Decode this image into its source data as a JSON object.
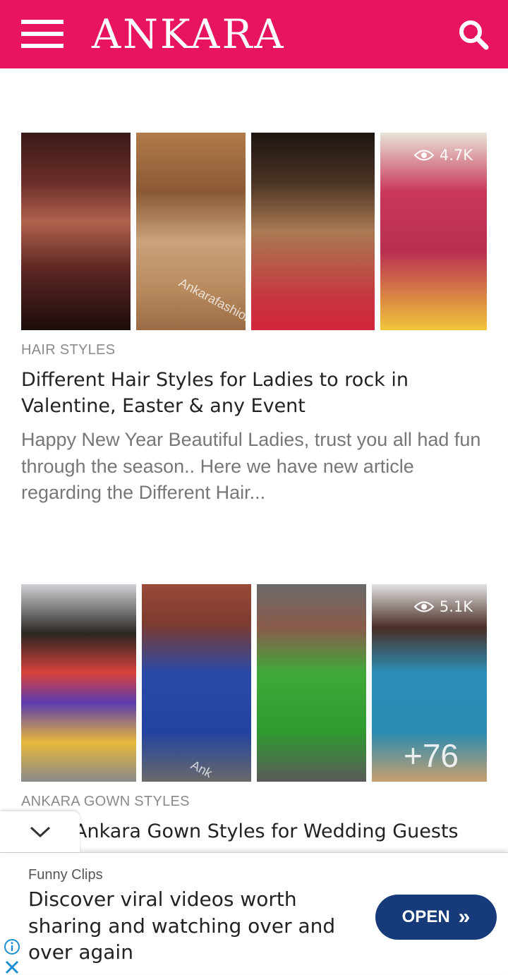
{
  "header": {
    "logo_text": "ANKARA",
    "menu_icon": "hamburger-icon",
    "search_icon": "search-icon",
    "brand_color": "#e8145f"
  },
  "articles": [
    {
      "views": "4.7K",
      "watermark": "Ankarafashion",
      "category": "HAIR STYLES",
      "title": "Different Hair Styles for Ladies to rock in Valentine, Easter & any Event",
      "excerpt": "Happy New Year Beautiful Ladies, trust you all had fun through the season.. Here we have new article regarding the Different Hair..."
    },
    {
      "views": "5.1K",
      "watermark": "Ank",
      "extra_count": "+76",
      "category": "ANKARA GOWN STYLES",
      "title": "Ankara Gown Styles for Wedding Guests"
    }
  ],
  "ad": {
    "source": "Funny Clips",
    "headline": "Discover viral videos worth sharing and watching over and over again",
    "cta": "OPEN",
    "cta_icon": "double-chevron-right-icon",
    "cta_color": "#163a7a",
    "info_icon": "info-icon",
    "close_icon": "close-icon"
  },
  "collapse_icon": "chevron-down-icon"
}
